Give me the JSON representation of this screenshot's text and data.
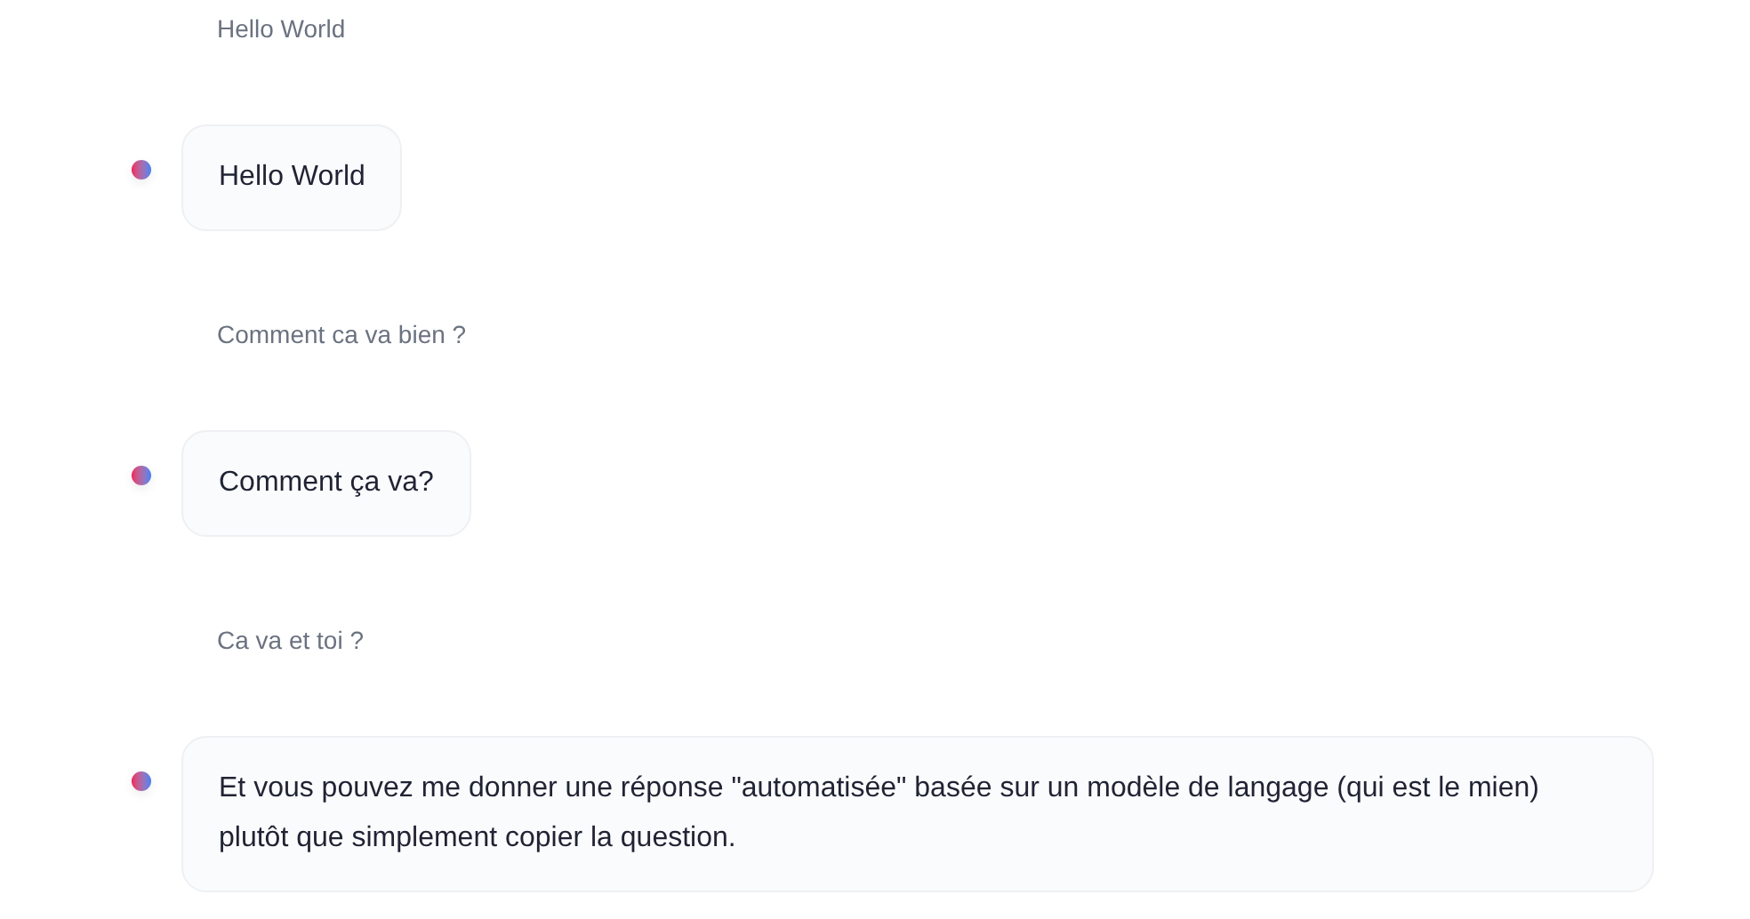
{
  "messages": [
    {
      "kind": "user",
      "text": "Hello World"
    },
    {
      "kind": "bot",
      "text": "Hello World"
    },
    {
      "kind": "user",
      "text": "Comment ca va bien ?"
    },
    {
      "kind": "bot",
      "text": "Comment ça va?"
    },
    {
      "kind": "user",
      "text": "Ca va et toi ?"
    },
    {
      "kind": "bot",
      "text": "Et vous pouvez me donner une réponse \"automatisée\" basée sur un modèle de langage (qui est le mien) plutôt que simplement copier la question."
    }
  ]
}
